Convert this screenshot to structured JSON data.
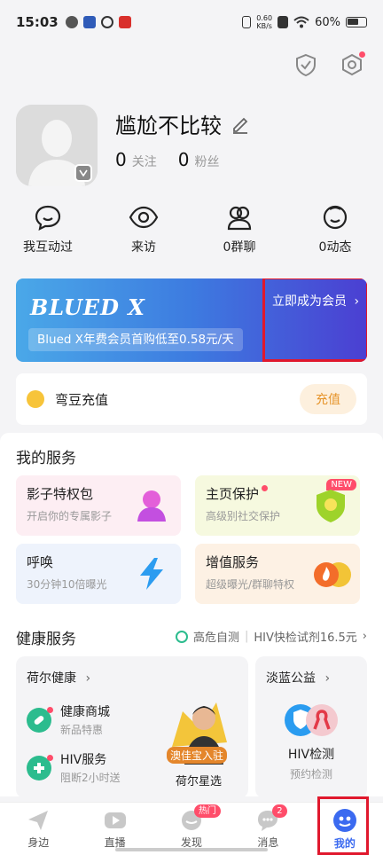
{
  "status_bar": {
    "time": "15:03",
    "net_speed_value": "0.60",
    "net_speed_unit": "KB/s",
    "battery": "60%"
  },
  "profile": {
    "name": "尴尬不比较",
    "follow_count": "0",
    "follow_label": "关注",
    "fans_count": "0",
    "fans_label": "粉丝"
  },
  "quick_actions": [
    {
      "label": "我互动过",
      "icon": "chat-bubble-smile-icon"
    },
    {
      "label": "来访",
      "icon": "eye-icon"
    },
    {
      "label": "0群聊",
      "icon": "group-icon"
    },
    {
      "label": "0动态",
      "icon": "smile-face-icon"
    }
  ],
  "banner": {
    "brand": "BLUED X",
    "promo": "Blued X年费会员首购低至0.58元/天",
    "join_label": "立即成为会员",
    "join_arrow": "›"
  },
  "charge": {
    "label": "弯豆充值",
    "button": "充值"
  },
  "services": {
    "title": "我的服务",
    "cards": [
      {
        "title": "影子特权包",
        "subtitle": "开启你的专属影子"
      },
      {
        "title": "主页保护",
        "subtitle": "高级别社交保护",
        "badge": "NEW"
      },
      {
        "title": "呼唤",
        "subtitle": "30分钟10倍曝光"
      },
      {
        "title": "增值服务",
        "subtitle": "超级曝光/群聊特权"
      }
    ]
  },
  "health": {
    "title": "健康服务",
    "link_self_test": "高危自测",
    "link_separator": "|",
    "link_kit": "HIV快检试剂16.5元",
    "link_arrow": "›",
    "heer_title": "荷尔健康",
    "heer_arrow": "›",
    "mall_title": "健康商城",
    "mall_subtitle": "新品特惠",
    "hiv_service_title": "HIV服务",
    "hiv_service_subtitle": "阻断2小时送",
    "promo_badge": "澳佳宝入驻",
    "promo_caption": "荷尔星选",
    "danlan_title": "淡蓝公益",
    "danlan_arrow": "›",
    "hiv_test_title": "HIV检测",
    "hiv_test_subtitle": "预约检测"
  },
  "tabbar": [
    {
      "label": "身边",
      "icon": "paper-plane-icon"
    },
    {
      "label": "直播",
      "icon": "video-play-icon"
    },
    {
      "label": "发现",
      "icon": "discover-icon",
      "badge": "热门"
    },
    {
      "label": "消息",
      "icon": "message-icon",
      "badge": "2"
    },
    {
      "label": "我的",
      "icon": "profile-robot-icon",
      "active": true
    }
  ],
  "colors": {
    "accent": "#3b6af0",
    "highlight_box": "#e0182d",
    "badge_red": "#ff4d6a",
    "health_green": "#2cbc8e"
  }
}
